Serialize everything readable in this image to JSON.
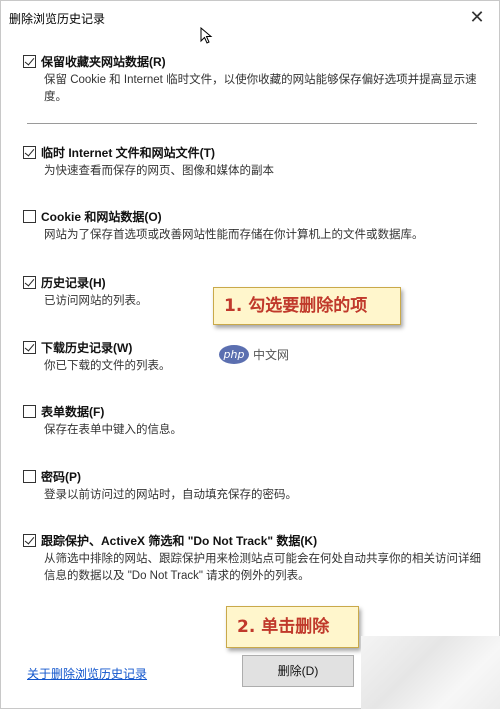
{
  "window": {
    "title": "删除浏览历史记录",
    "close_glyph": "✕"
  },
  "options": [
    {
      "label": "保留收藏夹网站数据(R)",
      "checked": true,
      "desc": "保留 Cookie 和 Internet 临时文件，以使你收藏的网站能够保存偏好选项并提高显示速度。"
    },
    {
      "label": "临时 Internet 文件和网站文件(T)",
      "checked": true,
      "desc": "为快速查看而保存的网页、图像和媒体的副本"
    },
    {
      "label": "Cookie 和网站数据(O)",
      "checked": false,
      "desc": "网站为了保存首选项或改善网站性能而存储在你计算机上的文件或数据库。"
    },
    {
      "label": "历史记录(H)",
      "checked": true,
      "desc": "已访问网站的列表。"
    },
    {
      "label": "下载历史记录(W)",
      "checked": true,
      "desc": "你已下载的文件的列表。"
    },
    {
      "label": "表单数据(F)",
      "checked": false,
      "desc": "保存在表单中键入的信息。"
    },
    {
      "label": "密码(P)",
      "checked": false,
      "desc": "登录以前访问过的网站时，自动填充保存的密码。"
    },
    {
      "label": "跟踪保护、ActiveX 筛选和 \"Do Not Track\" 数据(K)",
      "checked": true,
      "desc": "从筛选中排除的网站、跟踪保护用来检测站点可能会在何处自动共享你的相关访问详细信息的数据以及 \"Do Not Track\" 请求的例外的列表。"
    }
  ],
  "annotations": {
    "step1": "1. 勾选要删除的项",
    "step2": "2. 单击删除"
  },
  "watermark": {
    "logo": "php",
    "text": "中文网"
  },
  "footer": {
    "link": "关于删除浏览历史记录",
    "delete_button": "删除(D)"
  },
  "colors": {
    "callout_bg": "#fff6cc",
    "callout_text": "#c0392b",
    "link": "#1155cc",
    "button_bg": "#e1e1e1"
  }
}
